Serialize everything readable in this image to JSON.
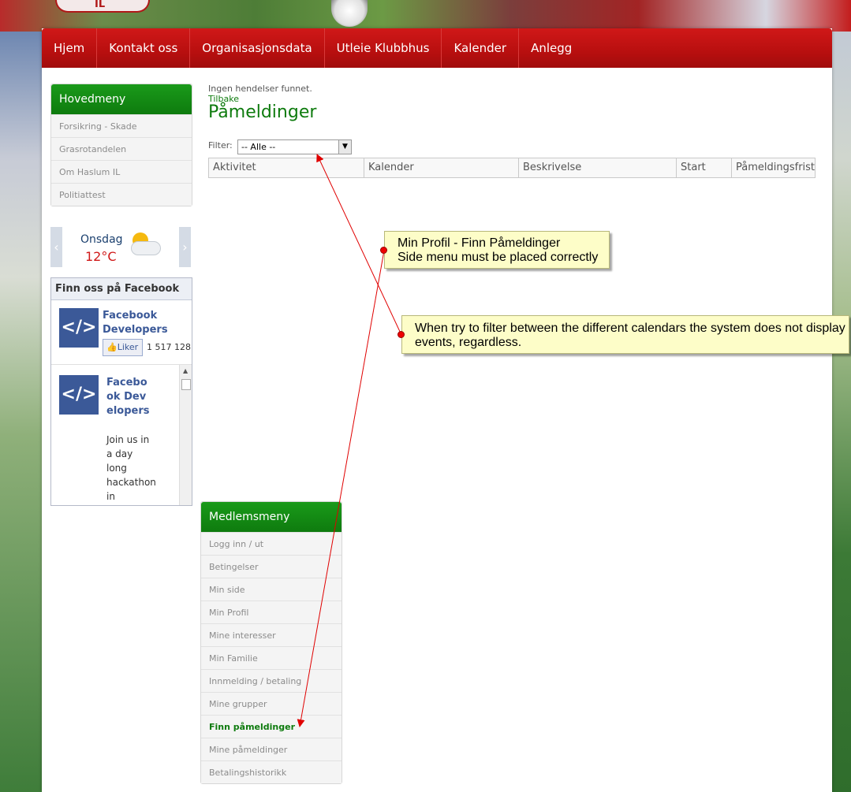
{
  "banner": {
    "logo_text": "IL"
  },
  "nav": {
    "items": [
      "Hjem",
      "Kontakt oss",
      "Organisasjonsdata",
      "Utleie Klubbhus",
      "Kalender",
      "Anlegg"
    ]
  },
  "main_menu": {
    "title": "Hovedmeny",
    "items": [
      "Forsikring - Skade",
      "Grasrotandelen",
      "Om Haslum IL",
      "Politiattest"
    ]
  },
  "weather": {
    "day": "Onsdag",
    "temp": "12°C",
    "prev": "‹",
    "next": "›"
  },
  "facebook": {
    "header": "Finn oss på Facebook",
    "page_name": "Facebook Developers",
    "like_label": "Liker",
    "like_count": "1 517 128",
    "post_title": "Facebook Developers",
    "post_text": "Join us in a day long hackathon in"
  },
  "content": {
    "no_events": "Ingen hendelser funnet.",
    "back_link": "Tilbake",
    "title": "Påmeldinger",
    "filter_label": "Filter:",
    "filter_value": "-- Alle --",
    "columns": [
      "Aktivitet",
      "Kalender",
      "Beskrivelse",
      "Start",
      "Påmeldingsfrist"
    ]
  },
  "member_menu": {
    "title": "Medlemsmeny",
    "items": [
      "Logg inn / ut",
      "Betingelser",
      "Min side",
      "Min Profil",
      "Mine interesser",
      "Min Familie",
      "Innmelding / betaling",
      "Mine grupper",
      "Finn påmeldinger",
      "Mine påmeldinger",
      "Betalingshistorikk"
    ],
    "active_index": 8
  },
  "annotations": [
    {
      "line1": "Min Profil - Finn Påmeldinger",
      "line2": "Side menu must be placed correctly"
    },
    {
      "line1": "When try to filter between the different calendars the system does not display",
      "line2": "events, regardless."
    }
  ],
  "colors": {
    "nav_red": "#c21414",
    "menu_green": "#0e7b0e",
    "note_yellow": "#fdfdc8",
    "arrow_red": "#e00000"
  }
}
